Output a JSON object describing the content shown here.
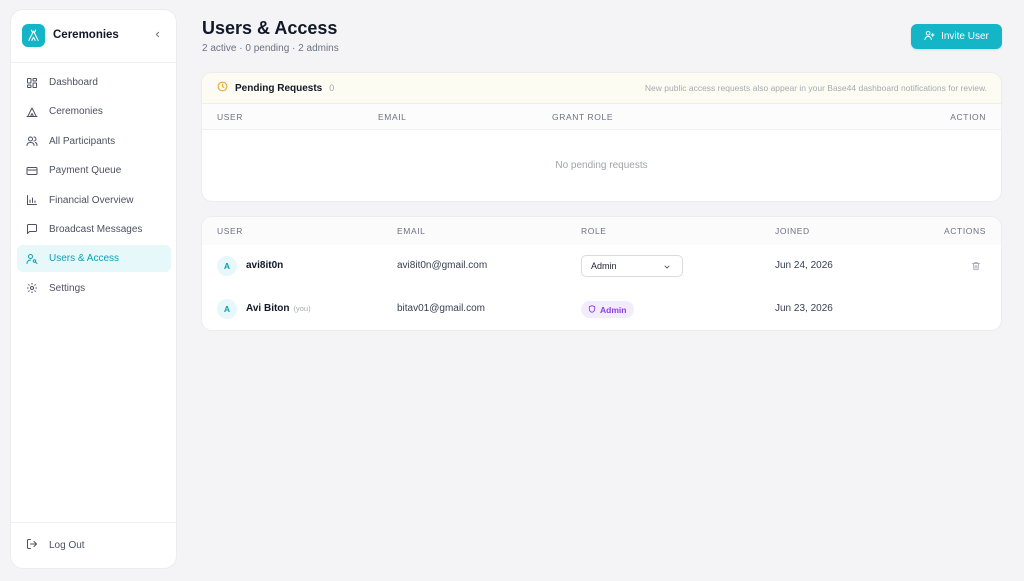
{
  "app": {
    "name": "Ceremonies"
  },
  "sidebar": {
    "items": [
      {
        "label": "Dashboard",
        "icon": "dashboard-icon"
      },
      {
        "label": "Ceremonies",
        "icon": "tent-icon"
      },
      {
        "label": "All Participants",
        "icon": "users-icon"
      },
      {
        "label": "Payment Queue",
        "icon": "credit-card-icon"
      },
      {
        "label": "Financial Overview",
        "icon": "bar-chart-icon"
      },
      {
        "label": "Broadcast Messages",
        "icon": "message-icon"
      },
      {
        "label": "Users & Access",
        "icon": "user-key-icon",
        "active": true
      },
      {
        "label": "Settings",
        "icon": "gear-icon"
      }
    ],
    "logout_label": "Log Out"
  },
  "page": {
    "title": "Users & Access",
    "subtitle": "2 active · 0 pending · 2 admins",
    "invite_label": "Invite User"
  },
  "pending": {
    "title": "Pending Requests",
    "count": "0",
    "note": "New public access requests also appear in your Base44 dashboard notifications for review.",
    "columns": {
      "user": "USER",
      "email": "EMAIL",
      "grant_role": "GRANT ROLE",
      "action": "ACTION"
    },
    "empty": "No pending requests"
  },
  "users": {
    "columns": {
      "user": "USER",
      "email": "EMAIL",
      "role": "ROLE",
      "joined": "JOINED",
      "actions": "ACTIONS"
    },
    "rows": [
      {
        "initial": "A",
        "name": "avi8it0n",
        "you": "",
        "email": "avi8it0n@gmail.com",
        "role": "Admin",
        "joined": "Jun 24, 2026"
      },
      {
        "initial": "A",
        "name": "Avi Biton",
        "you": "(you)",
        "email": "bitav01@gmail.com",
        "role": "Admin",
        "joined": "Jun 23, 2026"
      }
    ]
  },
  "colors": {
    "accent": "#13b5c7",
    "admin_badge": "#8b3ee6",
    "pending_icon": "#e9a33b"
  }
}
